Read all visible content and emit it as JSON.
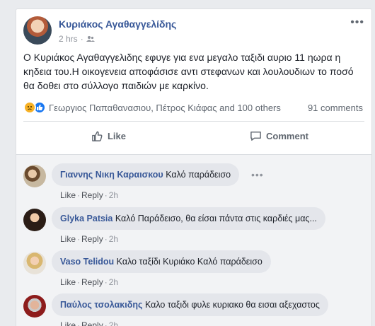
{
  "post": {
    "author": "Κυριάκος Αγαθαγγελίδης",
    "time": "2 hrs",
    "audience_icon": "friends-icon",
    "text": "Ο Κυριάκος Αγαθαγγελιδης εφυγε για ενα μεγαλο ταξιδι αυριο 11 ηωρα η κηδεια του.Η οικογενεια αποφάσισε αντι στεφανων και λουλουδιων το ποσό θα δοθει στο σύλλογο παιδιών με καρκίνο.",
    "reactions": {
      "icons": [
        "sad-reaction-icon",
        "like-reaction-icon"
      ],
      "reactors": "Γεωργιος Παπαθανασιου, Πέτρος Κιάφας and 100 others",
      "comments_count": "91 comments"
    },
    "actions": {
      "like": "Like",
      "comment": "Comment"
    }
  },
  "comments": [
    {
      "author": "Γιαννης Νικη Καραισκου",
      "text": "Καλό παράδεισο",
      "like": "Like",
      "reply": "Reply",
      "time": "2h"
    },
    {
      "author": "Glyka Patsia",
      "text": "Καλό Παράδεισο, θα είσαι πάντα στις καρδιές μας...",
      "like": "Like",
      "reply": "Reply",
      "time": "2h"
    },
    {
      "author": "Vaso Telidou",
      "text": "Καλο ταξίδι Κυριάκο Καλό παράδεισο",
      "like": "Like",
      "reply": "Reply",
      "time": "2h"
    },
    {
      "author": "Παύλος τσολακιδης",
      "text": "Καλο ταξιδι φυλε κυριακο θα εισαι αξεχαστος",
      "like": "Like",
      "reply": "Reply",
      "time": "2h"
    }
  ],
  "colors": {
    "link": "#385898",
    "background": "#e9ebee",
    "bubble": "#e4e6eb"
  }
}
